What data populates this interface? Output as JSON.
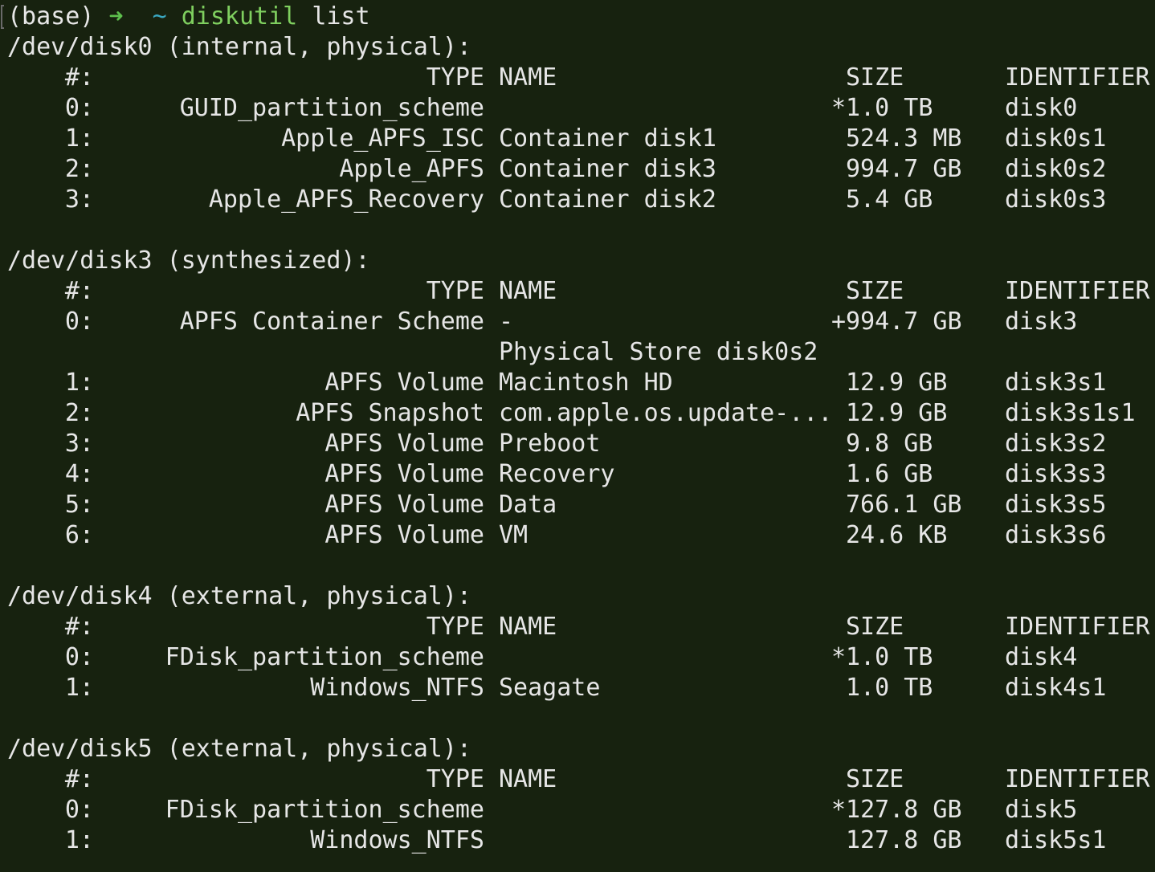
{
  "prompt": {
    "env": "(base)",
    "arrow": "➜",
    "dir": "~",
    "command": "diskutil",
    "args": "list"
  },
  "header": {
    "num": "#:",
    "type": "TYPE",
    "name": "NAME",
    "size": "SIZE",
    "identifier": "IDENTIFIER"
  },
  "disks": [
    {
      "title": "/dev/disk0 (internal, physical):",
      "rows": [
        {
          "num": "0:",
          "type": "GUID_partition_scheme",
          "name": "",
          "size": "*1.0 TB",
          "id": "disk0"
        },
        {
          "num": "1:",
          "type": "Apple_APFS_ISC",
          "name": "Container disk1",
          "size": "524.3 MB",
          "id": "disk0s1"
        },
        {
          "num": "2:",
          "type": "Apple_APFS",
          "name": "Container disk3",
          "size": "994.7 GB",
          "id": "disk0s2"
        },
        {
          "num": "3:",
          "type": "Apple_APFS_Recovery",
          "name": "Container disk2",
          "size": "5.4 GB",
          "id": "disk0s3"
        }
      ]
    },
    {
      "title": "/dev/disk3 (synthesized):",
      "rows": [
        {
          "num": "0:",
          "type": "APFS Container Scheme",
          "name": "-",
          "size": "+994.7 GB",
          "id": "disk3"
        },
        {
          "num": "",
          "type": "",
          "name": "Physical Store disk0s2",
          "size": "",
          "id": ""
        },
        {
          "num": "1:",
          "type": "APFS Volume",
          "name": "Macintosh HD",
          "size": "12.9 GB",
          "id": "disk3s1"
        },
        {
          "num": "2:",
          "type": "APFS Snapshot",
          "name": "com.apple.os.update-...",
          "size": "12.9 GB",
          "id": "disk3s1s1"
        },
        {
          "num": "3:",
          "type": "APFS Volume",
          "name": "Preboot",
          "size": "9.8 GB",
          "id": "disk3s2"
        },
        {
          "num": "4:",
          "type": "APFS Volume",
          "name": "Recovery",
          "size": "1.6 GB",
          "id": "disk3s3"
        },
        {
          "num": "5:",
          "type": "APFS Volume",
          "name": "Data",
          "size": "766.1 GB",
          "id": "disk3s5"
        },
        {
          "num": "6:",
          "type": "APFS Volume",
          "name": "VM",
          "size": "24.6 KB",
          "id": "disk3s6"
        }
      ]
    },
    {
      "title": "/dev/disk4 (external, physical):",
      "rows": [
        {
          "num": "0:",
          "type": "FDisk_partition_scheme",
          "name": "",
          "size": "*1.0 TB",
          "id": "disk4"
        },
        {
          "num": "1:",
          "type": "Windows_NTFS",
          "name": "Seagate",
          "size": "1.0 TB",
          "id": "disk4s1"
        }
      ]
    },
    {
      "title": "/dev/disk5 (external, physical):",
      "rows": [
        {
          "num": "0:",
          "type": "FDisk_partition_scheme",
          "name": "",
          "size": "*127.8 GB",
          "id": "disk5"
        },
        {
          "num": "1:",
          "type": "Windows_NTFS",
          "name": "",
          "size": "127.8 GB",
          "id": "disk5s1"
        }
      ]
    }
  ],
  "colors": {
    "background": "#17220f",
    "text": "#e6e6e6",
    "prompt_arrow": "#5ec04d",
    "prompt_dir": "#3aa8c1",
    "command": "#7fcf5f"
  }
}
